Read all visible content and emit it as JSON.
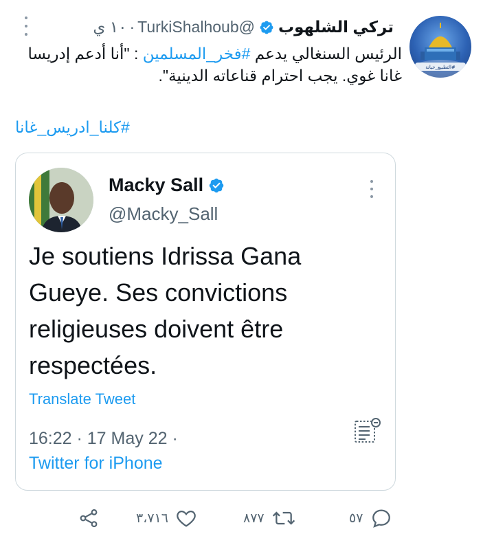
{
  "author": {
    "name": "تركي الشلهوب",
    "handle": "@TurkiShalhoub",
    "separator": "·",
    "time": "١٠ ي",
    "avatar_caption": "التطبيع_خيانة#"
  },
  "tweet": {
    "text_prefix": "الرئيس السنغالي يدعم ",
    "text_hashtag": "#فخر_المسلمين",
    "text_suffix": " : \"أنا أدعم إدريسا غانا غوي. يجب احترام قناعاته الدينية\".",
    "hashtag_line": "#كلنا_ادريس_غانا"
  },
  "quoted": {
    "name": "Macky Sall",
    "handle": "@Macky_Sall",
    "text": "Je soutiens Idrissa Gana Gueye. Ses convictions religieuses doivent être respectées.",
    "translate_label": "Translate Tweet",
    "timestamp": "16:22 · 17 May 22 ·",
    "source": "Twitter for iPhone"
  },
  "actions": {
    "replies": "٥٧",
    "retweets": "٨٧٧",
    "likes": "٣،٧١٦"
  },
  "colors": {
    "accent": "#1d9bf0",
    "text": "#0f1419",
    "muted": "#536471",
    "border": "#cfd9de"
  },
  "icons": [
    "more-icon",
    "verified-icon",
    "note-icon",
    "share-icon",
    "like-icon",
    "retweet-icon",
    "reply-icon"
  ]
}
